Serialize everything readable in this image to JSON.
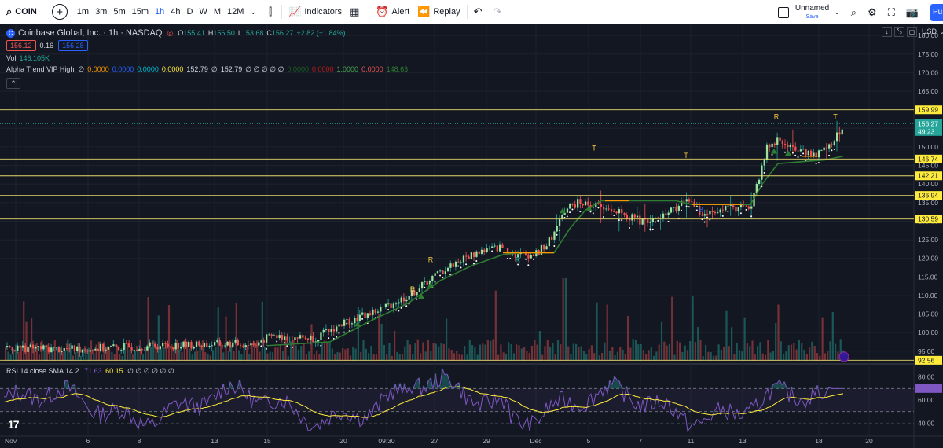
{
  "toolbar": {
    "symbol": "COIN",
    "timeframes": [
      "1m",
      "3m",
      "5m",
      "15m",
      "1h",
      "4h",
      "D",
      "W",
      "M",
      "12M"
    ],
    "active_timeframe": "1h",
    "indicators_label": "Indicators",
    "alert_label": "Alert",
    "replay_label": "Replay",
    "layout_name": "Unnamed",
    "layout_status": "Save",
    "publish_label": "Pu",
    "currency": "USD"
  },
  "legend": {
    "symbol_name": "Coinbase Global, Inc. · 1h · NASDAQ",
    "open": "155.41",
    "high": "156.50",
    "low": "153.68",
    "close": "156.27",
    "change": "+2.82 (+1.84%)",
    "bid": "156.12",
    "spread": "0.16",
    "ask": "156.28",
    "volume_label": "Vol",
    "volume_value": "146.105K",
    "indicator_name": "Alpha Trend VIP High",
    "indicator_values": [
      {
        "text": "∅",
        "color": "#d1d4dc"
      },
      {
        "text": "0.0000",
        "color": "#ff9800"
      },
      {
        "text": "0.0000",
        "color": "#2962ff"
      },
      {
        "text": "0.0000",
        "color": "#00bcd4"
      },
      {
        "text": "0.0000",
        "color": "#ffeb3b"
      },
      {
        "text": "152.79",
        "color": "#d1d4dc"
      },
      {
        "text": "∅",
        "color": "#d1d4dc"
      },
      {
        "text": "152.79",
        "color": "#d1d4dc"
      },
      {
        "text": "∅ ∅ ∅ ∅ ∅",
        "color": "#d1d4dc"
      },
      {
        "text": "0.0000",
        "color": "#1b5e20"
      },
      {
        "text": "0.0000",
        "color": "#b71c1c"
      },
      {
        "text": "1.0000",
        "color": "#4caf50"
      },
      {
        "text": "0.0000",
        "color": "#ef5350"
      },
      {
        "text": "148.63",
        "color": "#2e7d32"
      }
    ],
    "rsi_name": "RSI 14 close SMA 14 2",
    "rsi_value": "71.63",
    "rsi_sma_value": "60.15",
    "rsi_rest": "∅ ∅ ∅ ∅ ∅ ∅"
  },
  "price_axis": {
    "labels": [
      "180.00",
      "175.00",
      "170.00",
      "165.00",
      "160.00",
      "155.00",
      "150.00",
      "145.00",
      "140.00",
      "135.00",
      "130.00",
      "125.00",
      "120.00",
      "115.00",
      "110.00",
      "105.00",
      "100.00",
      "95.00"
    ],
    "current_price": "156.27",
    "countdown": "49:23",
    "level_labels": [
      "159.99",
      "146.74",
      "142.21",
      "136.94",
      "130.59",
      "92.56"
    ]
  },
  "rsi_axis": {
    "labels": [
      "80.00",
      "60.00",
      "40.00"
    ]
  },
  "time_axis": {
    "labels": [
      "Nov",
      "6",
      "8",
      "13",
      "15",
      "20",
      "09:30",
      "27",
      "29",
      "Dec",
      "5",
      "7",
      "11",
      "13",
      "18",
      "20"
    ]
  },
  "chart_data": {
    "type": "candlestick",
    "symbol": "COIN",
    "interval": "1h",
    "y_range": [
      92,
      183
    ],
    "horizontal_levels": [
      159.99,
      146.74,
      142.21,
      136.94,
      130.59,
      92.56
    ],
    "signals": [
      {
        "label": "R",
        "color": "#f5c842",
        "price": 111
      },
      {
        "label": "R",
        "color": "#f5c842",
        "price": 119
      },
      {
        "label": "R",
        "color": "#26a69a",
        "price": 119
      },
      {
        "label": "T",
        "color": "#f5c842",
        "price": 149
      },
      {
        "label": "T",
        "color": "#f5c842",
        "price": 147
      },
      {
        "label": "B",
        "color": "#2962ff",
        "price": 132.5
      },
      {
        "label": "R",
        "color": "#f5c842",
        "price": 157.5
      },
      {
        "label": "T",
        "color": "#f5c842",
        "price": 157.5
      }
    ],
    "rsi_range": [
      30,
      90
    ],
    "rsi_bands": [
      70,
      50
    ]
  },
  "colors": {
    "up": "#26a69a",
    "down": "#ef5350",
    "trend": "#2e7d32",
    "level": "#f0e68c",
    "accent": "#2962ff"
  }
}
